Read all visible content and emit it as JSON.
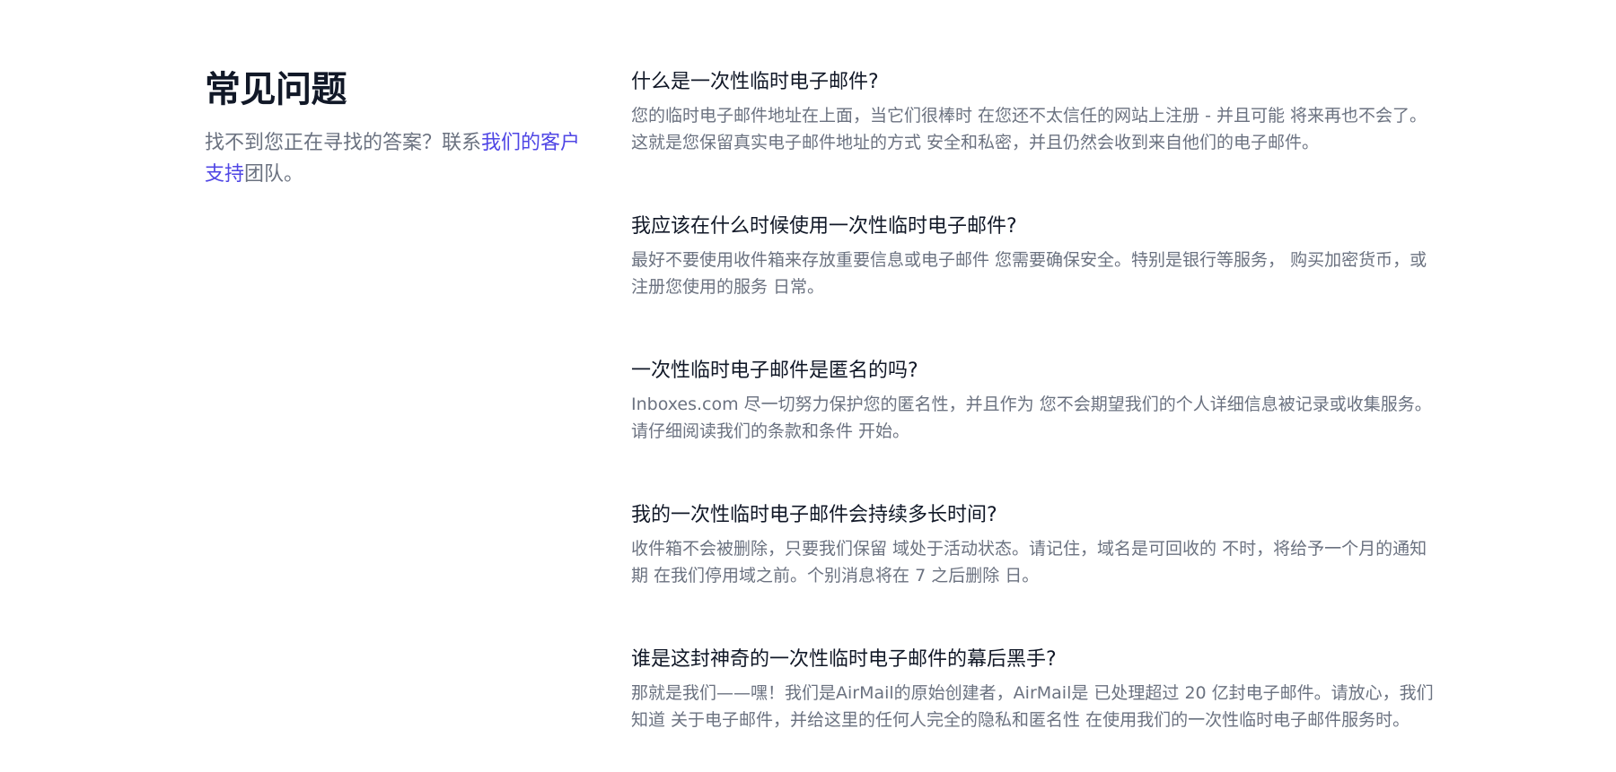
{
  "faq": {
    "title": "常见问题",
    "subtitle_before": "找不到您正在寻找的答案？联系",
    "support_link": "我们的客户支持",
    "subtitle_after": "团队。",
    "items": [
      {
        "question": "什么是一次性临时电子邮件?",
        "answer": "您的临时电子邮件地址在上面，当它们很棒时 在您还不太信任的网站上注册 - 并且可能 将来再也不会了。这就是您保留真实电子邮件地址的方式 安全和私密，并且仍然会收到来自他们的电子邮件。"
      },
      {
        "question": "我应该在什么时候使用一次性临时电子邮件?",
        "answer": "最好不要使用收件箱来存放重要信息或电子邮件 您需要确保安全。特别是银行等服务， 购买加密货币，或注册您使用的服务 日常。"
      },
      {
        "question": "一次性临时电子邮件是匿名的吗?",
        "answer": "Inboxes.com 尽一切努力保护您的匿名性，并且作为 您不会期望我们的个人详细信息被记录或收集服务。请仔细阅读我们的条款和条件 开始。"
      },
      {
        "question": "我的一次性临时电子邮件会持续多长时间?",
        "answer": "收件箱不会被删除，只要我们保留 域处于活动状态。请记住，域名是可回收的 不时，将给予一个月的通知期 在我们停用域之前。个别消息将在 7 之后删除 日。"
      },
      {
        "question": "谁是这封神奇的一次性临时电子邮件的幕后黑手?",
        "answer": "那就是我们——嘿！我们是AirMail的原始创建者，AirMail是 已处理超过 20 亿封电子邮件。请放心，我们知道 关于电子邮件，并给这里的任何人完全的隐私和匿名性 在使用我们的一次性临时电子邮件服务时。"
      }
    ]
  }
}
